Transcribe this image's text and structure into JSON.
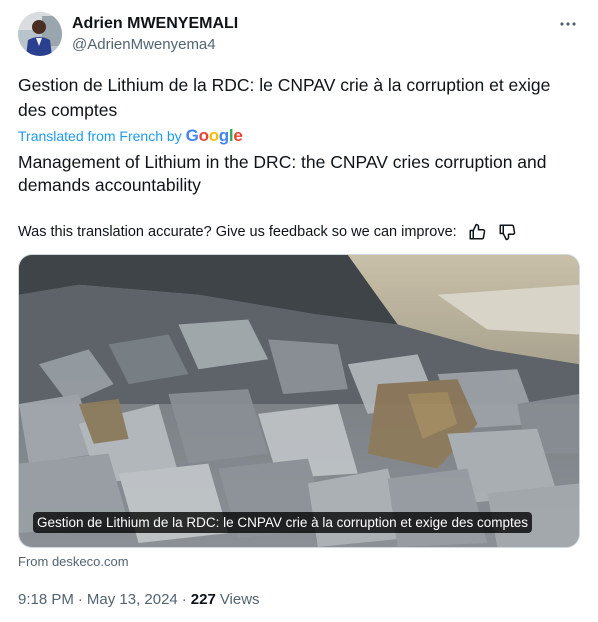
{
  "author": {
    "display_name": "Adrien MWENYEMALI",
    "handle": "@AdrienMwenyema4"
  },
  "tweet": {
    "text": "Gestion de Lithium de la RDC: le CNPAV crie à la corruption et exige des comptes",
    "translated_label": "Translated from French by",
    "translator_brand": "Google",
    "translation": "Management of Lithium in the DRC: the CNPAV cries corruption and demands accountability",
    "feedback_prompt": "Was this translation accurate? Give us feedback so we can improve:"
  },
  "media": {
    "caption": "Gestion de Lithium de la RDC: le CNPAV crie à la corruption et exige des comptes",
    "source": "From deskeco.com"
  },
  "meta": {
    "time": "9:18 PM",
    "date": "May 13, 2024",
    "views_count": "227",
    "views_label": "Views"
  },
  "icons": [
    "more-icon",
    "thumbs-up-icon",
    "thumbs-down-icon"
  ],
  "colors": {
    "link": "#1d9bf0",
    "secondary_text": "#536471",
    "primary_text": "#0f1419"
  }
}
